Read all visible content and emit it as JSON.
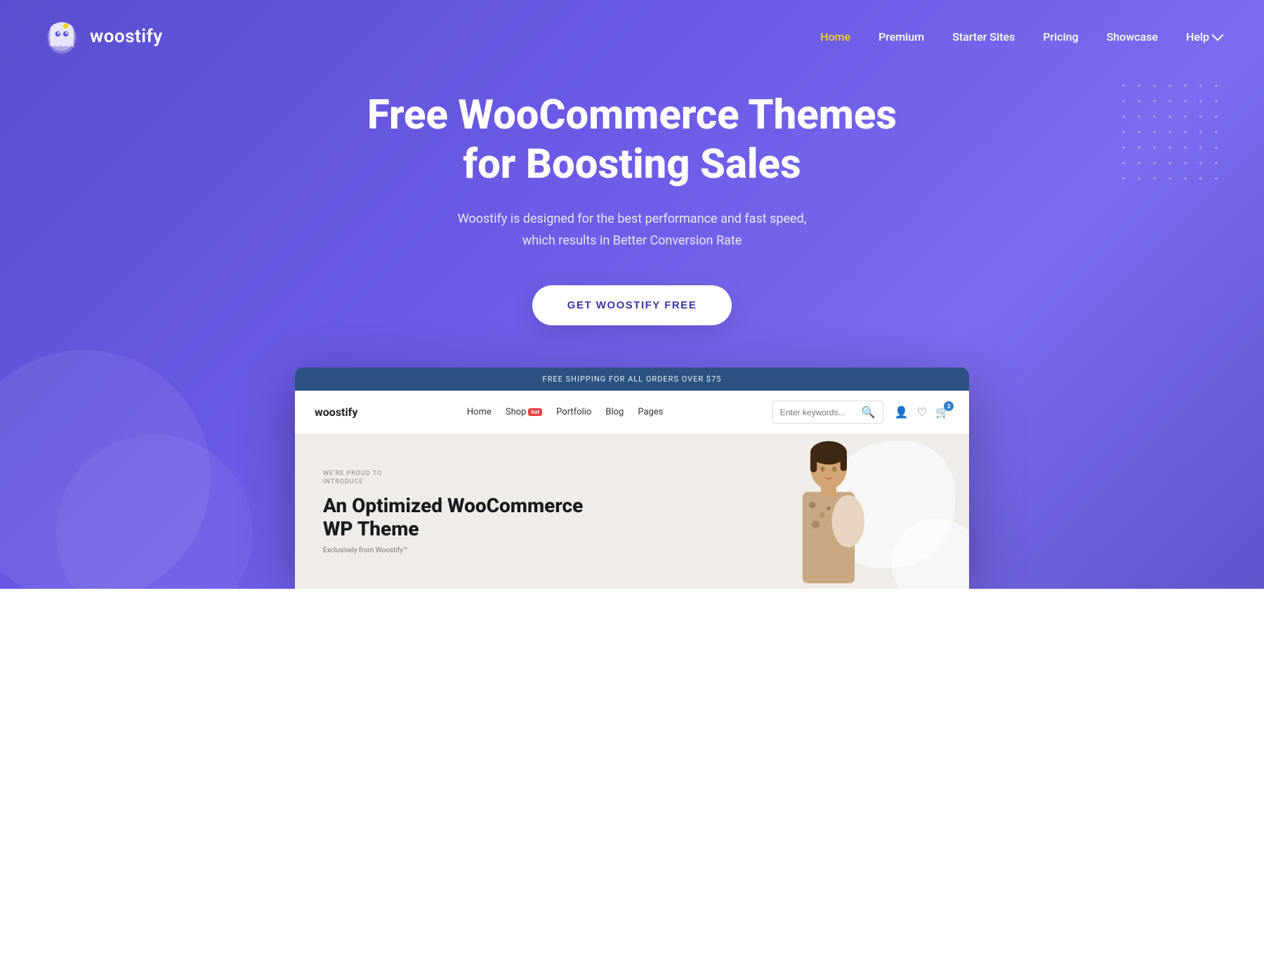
{
  "brand": {
    "name": "woostify"
  },
  "nav": {
    "links": [
      {
        "id": "home",
        "label": "Home",
        "active": true
      },
      {
        "id": "premium",
        "label": "Premium",
        "active": false
      },
      {
        "id": "starter-sites",
        "label": "Starter Sites",
        "active": false
      },
      {
        "id": "pricing",
        "label": "Pricing",
        "active": false
      },
      {
        "id": "showcase",
        "label": "Showcase",
        "active": false
      }
    ],
    "help_label": "Help"
  },
  "hero": {
    "title": "Free WooCommerce Themes for Boosting Sales",
    "subtitle_line1": "Woostify is designed for the best performance and fast speed,",
    "subtitle_line2": "which results in Better Conversion Rate",
    "cta_label": "GET WOOSTIFY FREE"
  },
  "browser_preview": {
    "announcement": "FREE SHIPPING FOR ALL ORDERS OVER $75",
    "inner_logo": "woostify",
    "inner_nav_links": [
      {
        "label": "Home",
        "badge": null
      },
      {
        "label": "Shop",
        "badge": "hot"
      },
      {
        "label": "Portfolio",
        "badge": null
      },
      {
        "label": "Blog",
        "badge": null
      },
      {
        "label": "Pages",
        "badge": null
      }
    ],
    "search_placeholder": "Enter keywords...",
    "cart_count": "3",
    "inner_hero": {
      "eyebrow": "WE'RE PROUD TO\nINTRODUCE",
      "title": "An Optimized WooCommerce WP Theme",
      "subtitle": "Exclusively from Woostify™"
    }
  },
  "colors": {
    "hero_gradient_start": "#5a4fcf",
    "hero_gradient_end": "#7b6cf0",
    "nav_active": "#f5d020",
    "cta_text": "#3a35a8",
    "browser_bar": "#2c5282"
  }
}
